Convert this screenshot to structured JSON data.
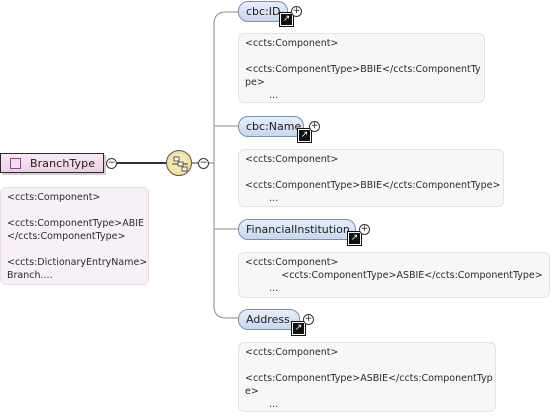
{
  "root": {
    "label": "BranchType",
    "doc": [
      "<ccts:Component>",
      "",
      "<ccts:ComponentType>ABIE",
      "</ccts:ComponentType>",
      "",
      "<ccts:DictionaryEntryName>",
      "Branch...."
    ]
  },
  "collapse_symbol": "−",
  "expand_symbol": "+",
  "link_icon": "link-arrow-icon",
  "children": [
    {
      "label": "cbc:ID",
      "doc": [
        "<ccts:Component>",
        "",
        "<ccts:ComponentType>BBIE</ccts:ComponentTy",
        "pe>",
        "        ..."
      ]
    },
    {
      "label": "cbc:Name",
      "doc": [
        "<ccts:Component>",
        "",
        "<ccts:ComponentType>BBIE</ccts:ComponentType>",
        "        ..."
      ]
    },
    {
      "label": "FinancialInstitution",
      "doc": [
        "<ccts:Component>",
        "            <ccts:ComponentType>ASBIE</ccts:ComponentType>",
        "        ..."
      ]
    },
    {
      "label": "Address",
      "doc": [
        "<ccts:Component>",
        "",
        "<ccts:ComponentType>ASBIE</ccts:ComponentTyp",
        "e>",
        "        ..."
      ]
    }
  ]
}
